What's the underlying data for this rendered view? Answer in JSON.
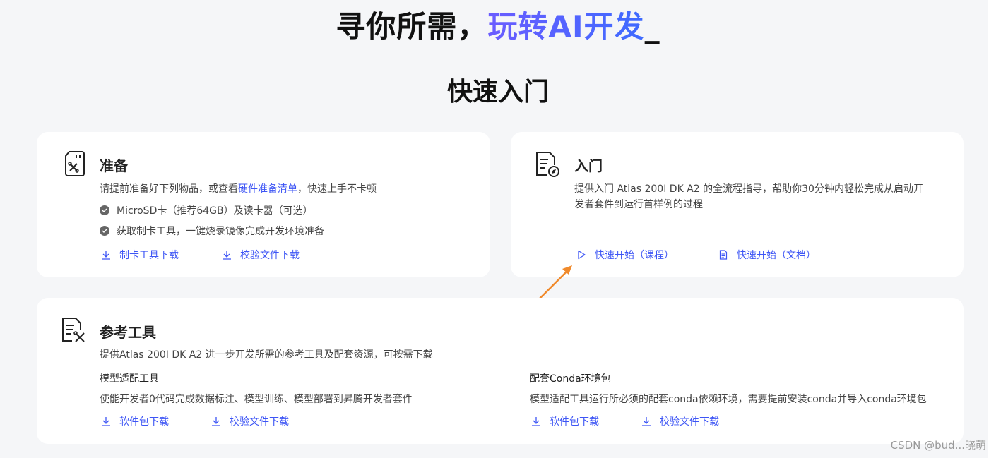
{
  "hero": {
    "prefix": "寻你所需，",
    "accent": "玩转AI开发",
    "cursor": "_"
  },
  "section_title": "快速入门",
  "prepare": {
    "title": "准备",
    "desc_before": "请提前准备好下列物品，或查看",
    "desc_link": "硬件准备清单",
    "desc_after": "，快速上手不卡顿",
    "items": [
      "MicroSD卡（推荐64GB）及读卡器（可选）",
      "获取制卡工具，一键烧录镜像完成开发环境准备"
    ],
    "actions": [
      "制卡工具下载",
      "校验文件下载"
    ]
  },
  "intro": {
    "title": "入门",
    "desc_line1": "提供入门 Atlas 200I DK A2 的全流程指导，帮助你30分钟内轻松完成从启动开",
    "desc_line2": "发者套件到运行首样例的过程",
    "actions": [
      "快速开始（课程）",
      "快速开始（文档）"
    ]
  },
  "reference": {
    "title": "参考工具",
    "desc": "提供Atlas 200I DK A2 进一步开发所需的参考工具及配套资源，可按需下载",
    "left": {
      "subtitle": "模型适配工具",
      "desc": "使能开发者0代码完成数据标注、模型训练、模型部署到昇腾开发者套件",
      "actions": [
        "软件包下载",
        "校验文件下载"
      ]
    },
    "right": {
      "subtitle": "配套Conda环境包",
      "desc": "模型适配工具运行所必须的配套conda依赖环境，需要提前安装conda并导入conda环境包",
      "actions": [
        "软件包下载",
        "校验文件下载"
      ]
    }
  },
  "watermark": "CSDN @bud...晓萌",
  "colors": {
    "accent": "#3d55f5",
    "annotation_arrow": "#f08a2c",
    "background": "#f5f6f8"
  }
}
